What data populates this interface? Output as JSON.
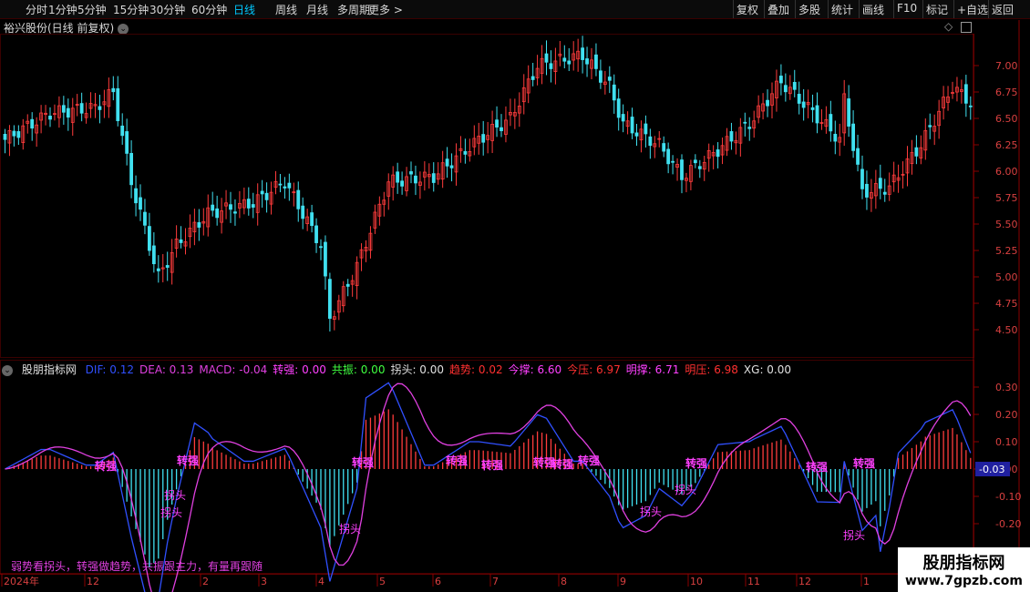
{
  "toolbar": {
    "periods": [
      "分时",
      "1分钟",
      "5分钟",
      "15分钟",
      "30分钟",
      "60分钟",
      "日线",
      "周线",
      "月线",
      "多周期",
      "更多 >"
    ],
    "active": "日线",
    "right": [
      "复权",
      "叠加",
      "多股",
      "统计",
      "画线",
      "F10",
      "标记",
      "+自选",
      "返回"
    ]
  },
  "chart_title": "裕兴股份(日线 前复权)",
  "indicator_name": "股朋指标网",
  "legend": [
    {
      "label": "DIF:",
      "value": "0.12",
      "color": "#3050ff"
    },
    {
      "label": "DEA:",
      "value": "0.13",
      "color": "#e040e0"
    },
    {
      "label": "MACD:",
      "value": "-0.04",
      "color": "#e040e0"
    },
    {
      "label": "转强:",
      "value": "0.00",
      "color": "#ff40ff"
    },
    {
      "label": "共振:",
      "value": "0.00",
      "color": "#40ff40"
    },
    {
      "label": "拐头:",
      "value": "0.00",
      "color": "#e0e0e0"
    },
    {
      "label": "趋势:",
      "value": "0.02",
      "color": "#ff3030"
    },
    {
      "label": "今撑:",
      "value": "6.60",
      "color": "#ff40ff"
    },
    {
      "label": "今压:",
      "value": "6.97",
      "color": "#ff3030"
    },
    {
      "label": "明撑:",
      "value": "6.71",
      "color": "#ff40ff"
    },
    {
      "label": "明压:",
      "value": "6.98",
      "color": "#ff3030"
    },
    {
      "label": "XG:",
      "value": "0.00",
      "color": "#e0e0e0"
    }
  ],
  "price_axis": [
    "7.00",
    "6.75",
    "6.50",
    "6.25",
    "6.00",
    "5.75",
    "5.50",
    "5.25",
    "5.00",
    "4.75",
    "4.50"
  ],
  "macd_axis": [
    "0.30",
    "0.20",
    "0.10",
    "0.00",
    "-0.10",
    "-0.20"
  ],
  "current_macd": "-0.03",
  "date_axis": [
    {
      "label": "2024年"
    },
    {
      "label": "12"
    },
    {
      "label": "2"
    },
    {
      "label": "3"
    },
    {
      "label": "4"
    },
    {
      "label": "5"
    },
    {
      "label": "6"
    },
    {
      "label": "7"
    },
    {
      "label": "8"
    },
    {
      "label": "9"
    },
    {
      "label": "10"
    },
    {
      "label": "11"
    },
    {
      "label": "12"
    },
    {
      "label": "1"
    }
  ],
  "slogan": "弱势看拐头，转强做趋势，共振跟主力，有量再跟随",
  "labels": {
    "turn": "拐头",
    "strong": "转强"
  },
  "watermark": {
    "line1": "股朋指标网",
    "line2": "www.7gpzb.com"
  },
  "colors": {
    "up": "#ff3c3c",
    "down": "#40e0f0",
    "dif": "#3050ff",
    "dea": "#e040e0",
    "grid": "#3a0000"
  }
}
